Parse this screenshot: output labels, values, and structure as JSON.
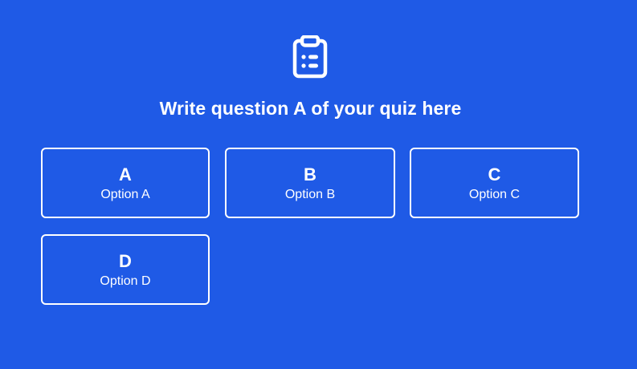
{
  "quiz": {
    "icon": "clipboard-list-icon",
    "question": "Write question A of your quiz here",
    "options": [
      {
        "letter": "A",
        "label": "Option A"
      },
      {
        "letter": "B",
        "label": "Option B"
      },
      {
        "letter": "C",
        "label": "Option C"
      },
      {
        "letter": "D",
        "label": "Option D"
      }
    ]
  },
  "colors": {
    "background": "#1f5ae6",
    "foreground": "#ffffff"
  }
}
